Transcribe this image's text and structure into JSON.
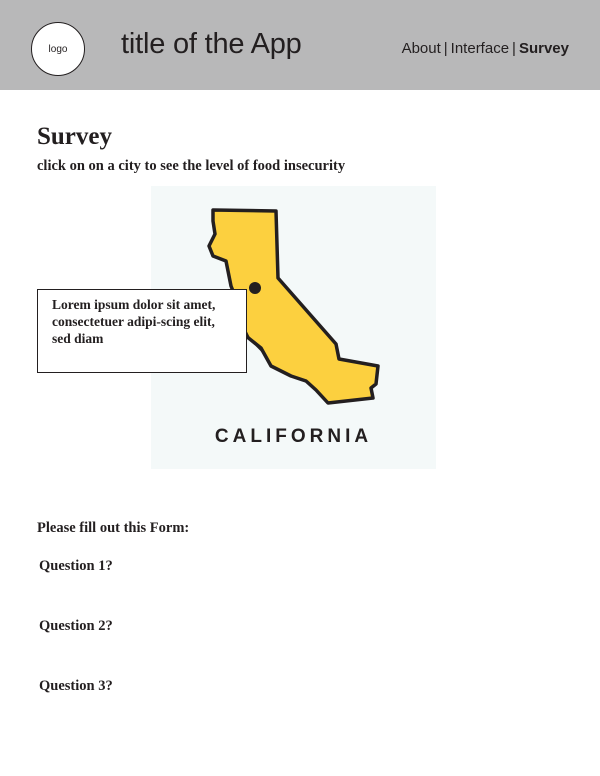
{
  "header": {
    "logo_text": "logo",
    "app_title": "title of the App",
    "nav": {
      "about": "About",
      "interface": "Interface",
      "survey": "Survey",
      "separator": "|"
    }
  },
  "main": {
    "title": "Survey",
    "subtitle": "click on on a city to see the level of food insecurity",
    "map": {
      "label": "CALIFORNIA",
      "state_color": "#fcd03f",
      "background_color": "#f4f9f9"
    },
    "tooltip_text": "Lorem ipsum dolor sit amet, consectetuer adipi-scing elit, sed diam"
  },
  "form": {
    "intro": "Please fill out this Form:",
    "questions": [
      "Question 1?",
      "Question 2?",
      "Question 3?"
    ]
  },
  "colors": {
    "header_bg": "#b8b8b9",
    "text": "#231f20"
  }
}
